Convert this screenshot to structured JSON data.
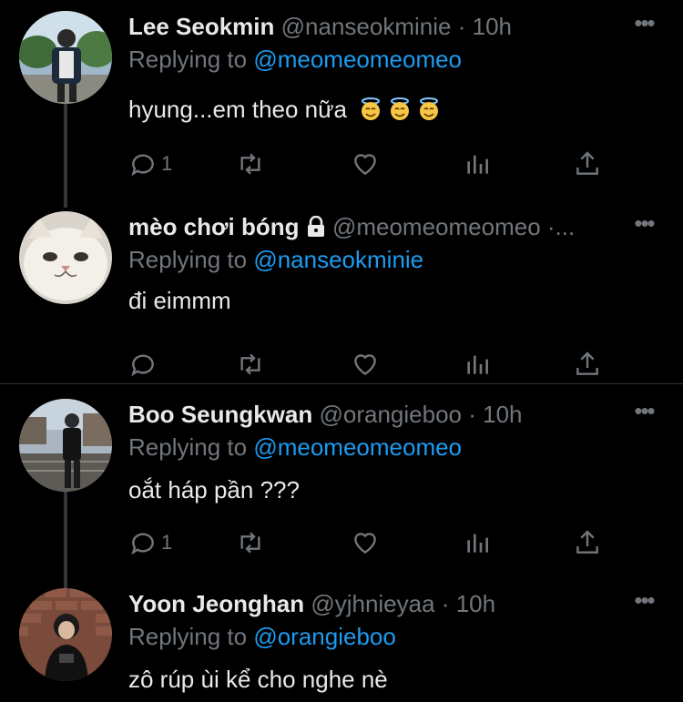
{
  "tweets": [
    {
      "name": "Lee Seokmin",
      "handle": "@nanseokminie",
      "dot": "·",
      "time": "10h",
      "replying_label": "Replying to",
      "replying_to": "@meomeomeomeo",
      "text": "hyung...em theo nữa",
      "emojis": [
        "innocent-emoji",
        "innocent-emoji",
        "innocent-emoji"
      ],
      "reply_count": "1",
      "locked": false
    },
    {
      "name": "mèo chơi bóng",
      "handle": "@meomeomeomeo ·...",
      "dot": "",
      "time": "",
      "replying_label": "Replying to",
      "replying_to": "@nanseokminie",
      "text": "đi eimmm",
      "emojis": [],
      "reply_count": "",
      "locked": true
    },
    {
      "name": "Boo Seungkwan",
      "handle": "@orangieboo",
      "dot": "·",
      "time": "10h",
      "replying_label": "Replying to",
      "replying_to": "@meomeomeomeo",
      "text": "oắt háp pần ???",
      "emojis": [],
      "reply_count": "1",
      "locked": false
    },
    {
      "name": "Yoon Jeonghan",
      "handle": "@yjhnieyaa",
      "dot": "·",
      "time": "10h",
      "replying_label": "Replying to",
      "replying_to": "@orangieboo",
      "text": "zô rúp ùi kể cho nghe nè",
      "emojis": [],
      "reply_count": "",
      "locked": false
    }
  ],
  "more_label": "•••",
  "icons": {
    "reply": "reply-icon",
    "retweet": "retweet-icon",
    "like": "heart-icon",
    "views": "views-icon",
    "share": "share-icon",
    "more": "more-icon",
    "lock": "lock-icon"
  },
  "colors": {
    "background": "#000000",
    "text": "#e7e9ea",
    "muted": "#71767b",
    "link": "#1d9bf0",
    "divider": "#2f3336"
  }
}
